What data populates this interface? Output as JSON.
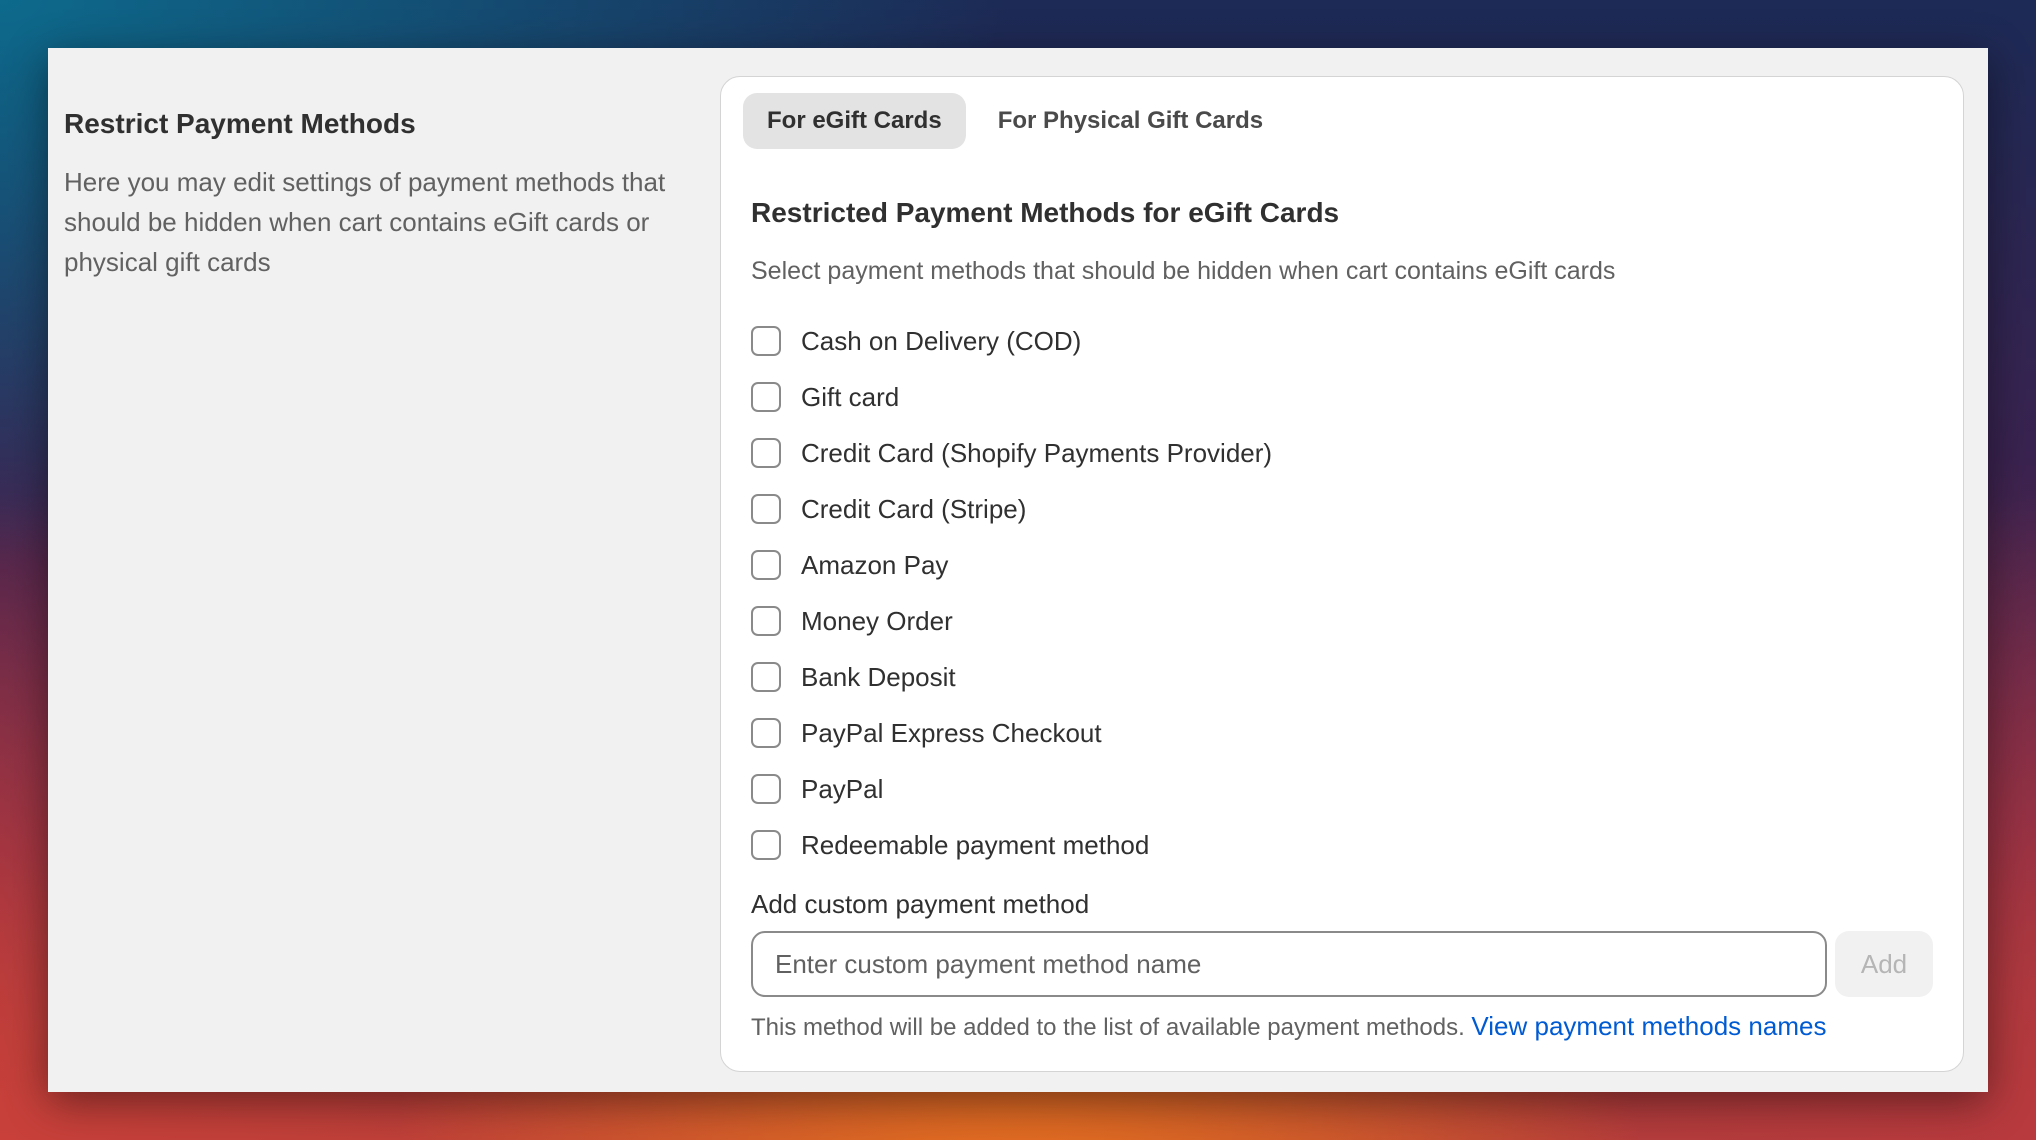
{
  "left_section": {
    "title": "Restrict Payment Methods",
    "description": "Here you may edit settings of payment methods that should be hidden when cart contains eGift cards or physical gift cards"
  },
  "tabs": [
    {
      "label": "For eGift Cards",
      "active": true
    },
    {
      "label": "For Physical Gift Cards",
      "active": false
    }
  ],
  "panel": {
    "title": "Restricted Payment Methods for eGift Cards",
    "subtitle": "Select payment methods that should be hidden when cart contains eGift cards"
  },
  "payment_methods": [
    {
      "label": "Cash on Delivery (COD)",
      "checked": false
    },
    {
      "label": "Gift card",
      "checked": false
    },
    {
      "label": "Credit Card (Shopify Payments Provider)",
      "checked": false
    },
    {
      "label": "Credit Card (Stripe)",
      "checked": false
    },
    {
      "label": "Amazon Pay",
      "checked": false
    },
    {
      "label": "Money Order",
      "checked": false
    },
    {
      "label": "Bank Deposit",
      "checked": false
    },
    {
      "label": "PayPal Express Checkout",
      "checked": false
    },
    {
      "label": "PayPal",
      "checked": false
    },
    {
      "label": "Redeemable payment method",
      "checked": false
    }
  ],
  "custom_method": {
    "label": "Add custom payment method",
    "placeholder": "Enter custom payment method name",
    "value": "",
    "add_label": "Add",
    "helper_text": "This method will be added to the list of available payment methods.",
    "helper_link": "View payment methods names"
  },
  "colors": {
    "link": "#005bd3",
    "text_primary": "#303030",
    "text_secondary": "#616161",
    "window_bg": "#f1f1f1",
    "card_bg": "#ffffff"
  }
}
